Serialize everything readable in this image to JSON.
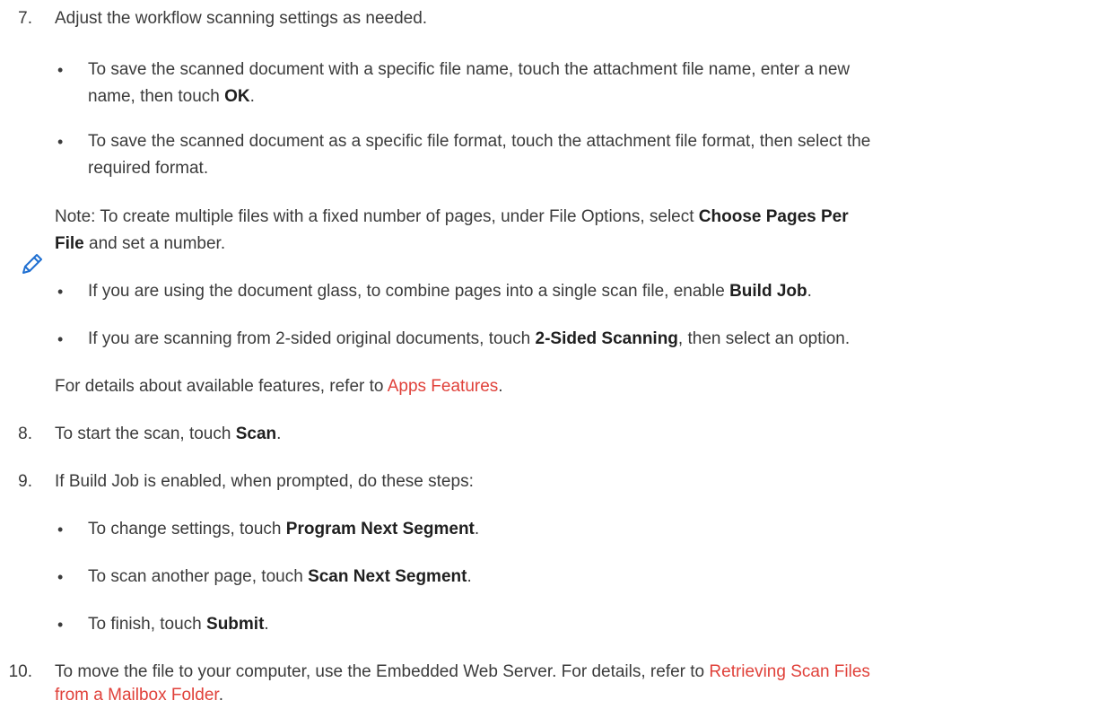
{
  "step7": {
    "number": "7.",
    "text": "Adjust the workflow scanning settings as needed.",
    "b1_a": "To save the scanned document with a specific file name, touch the attachment file name, enter a new",
    "b1_b": "name, then touch ",
    "b1_bold": "OK",
    "b1_end": ".",
    "b2_a": "To save the scanned document as a specific file format, touch the attachment file format, then select the",
    "b2_b": "required format.",
    "note_a": "Note: To create multiple files with a fixed number of pages, under File Options, select ",
    "note_bold_a": "Choose Pages Per",
    "note_bold_b": "File",
    "note_b": " and set a number.",
    "b3_a": "If you are using the document glass, to combine pages into a single scan file, enable ",
    "b3_bold": "Build Job",
    "b3_end": ".",
    "b4_a": "If you are scanning from 2-sided original documents, touch ",
    "b4_bold": "2-Sided Scanning",
    "b4_end": ", then select an option.",
    "details_a": "For details about available features, refer to ",
    "details_link": "Apps Features",
    "details_end": "."
  },
  "step8": {
    "number": "8.",
    "text_a": "To start the scan, touch ",
    "bold": "Scan",
    "end": "."
  },
  "step9": {
    "number": "9.",
    "text": "If Build Job is enabled, when prompted, do these steps:",
    "b1_a": "To change settings, touch ",
    "b1_bold": "Program Next Segment",
    "b1_end": ".",
    "b2_a": "To scan another page, touch ",
    "b2_bold": "Scan Next Segment",
    "b2_end": ".",
    "b3_a": "To finish, touch ",
    "b3_bold": "Submit",
    "b3_end": "."
  },
  "step10": {
    "number": "10.",
    "text_a": "To move the file to your computer, use the Embedded Web Server. For details, refer to ",
    "link_a": "Retrieving Scan Files",
    "link_b": "from a Mailbox Folder",
    "end": "."
  },
  "bullet_char": "•",
  "colors": {
    "text": "#3b3b3b",
    "link": "#e0413a",
    "icon": "#1f6fd1"
  },
  "icons": {
    "note": "pencil-icon"
  }
}
